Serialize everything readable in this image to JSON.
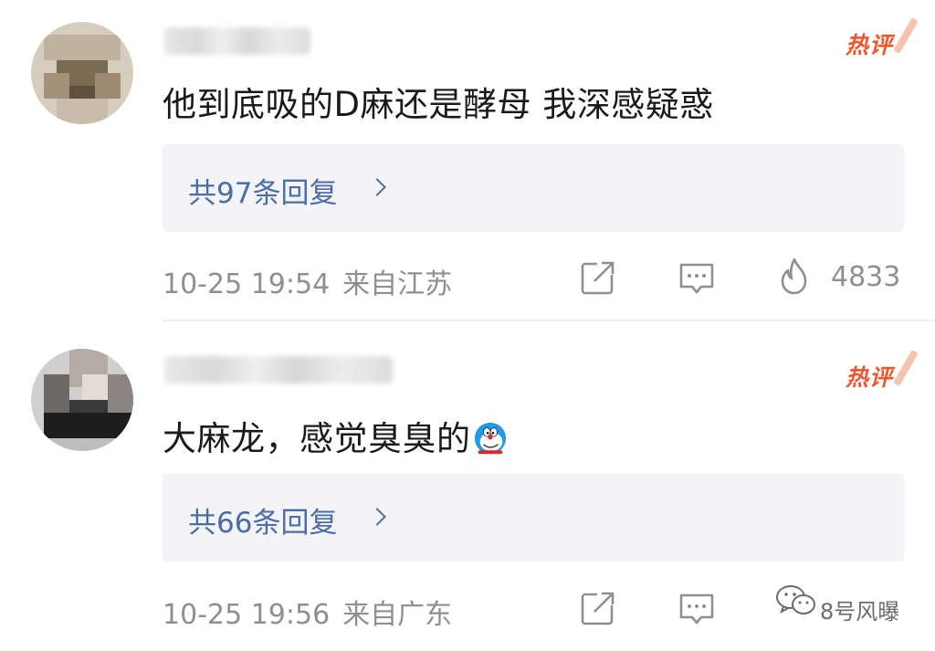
{
  "comments": [
    {
      "badge": "热评",
      "text": "他到底吸的D麻还是酵母 我深感疑惑",
      "replies_label": "共97条回复",
      "date": "10-25 19:54",
      "location": "来自江苏",
      "likes": "4833"
    },
    {
      "badge": "热评",
      "text": "大麻龙，感觉臭臭的",
      "replies_label": "共66条回复",
      "date": "10-25 19:56",
      "location": "来自广东"
    }
  ],
  "watermark": {
    "text": "8号风曝"
  },
  "icons": {
    "share": "share-icon",
    "comment": "comment-icon",
    "like": "like-fire-icon",
    "emoji": "doraemon-emoji-icon",
    "chevron": "chevron-right-icon",
    "watermark": "wechat-icon"
  },
  "colors": {
    "accent_link": "#4a6ea5",
    "hot_badge": "#f0562d",
    "meta_text": "#8f8f8f",
    "reply_bg": "#f4f4f6"
  }
}
